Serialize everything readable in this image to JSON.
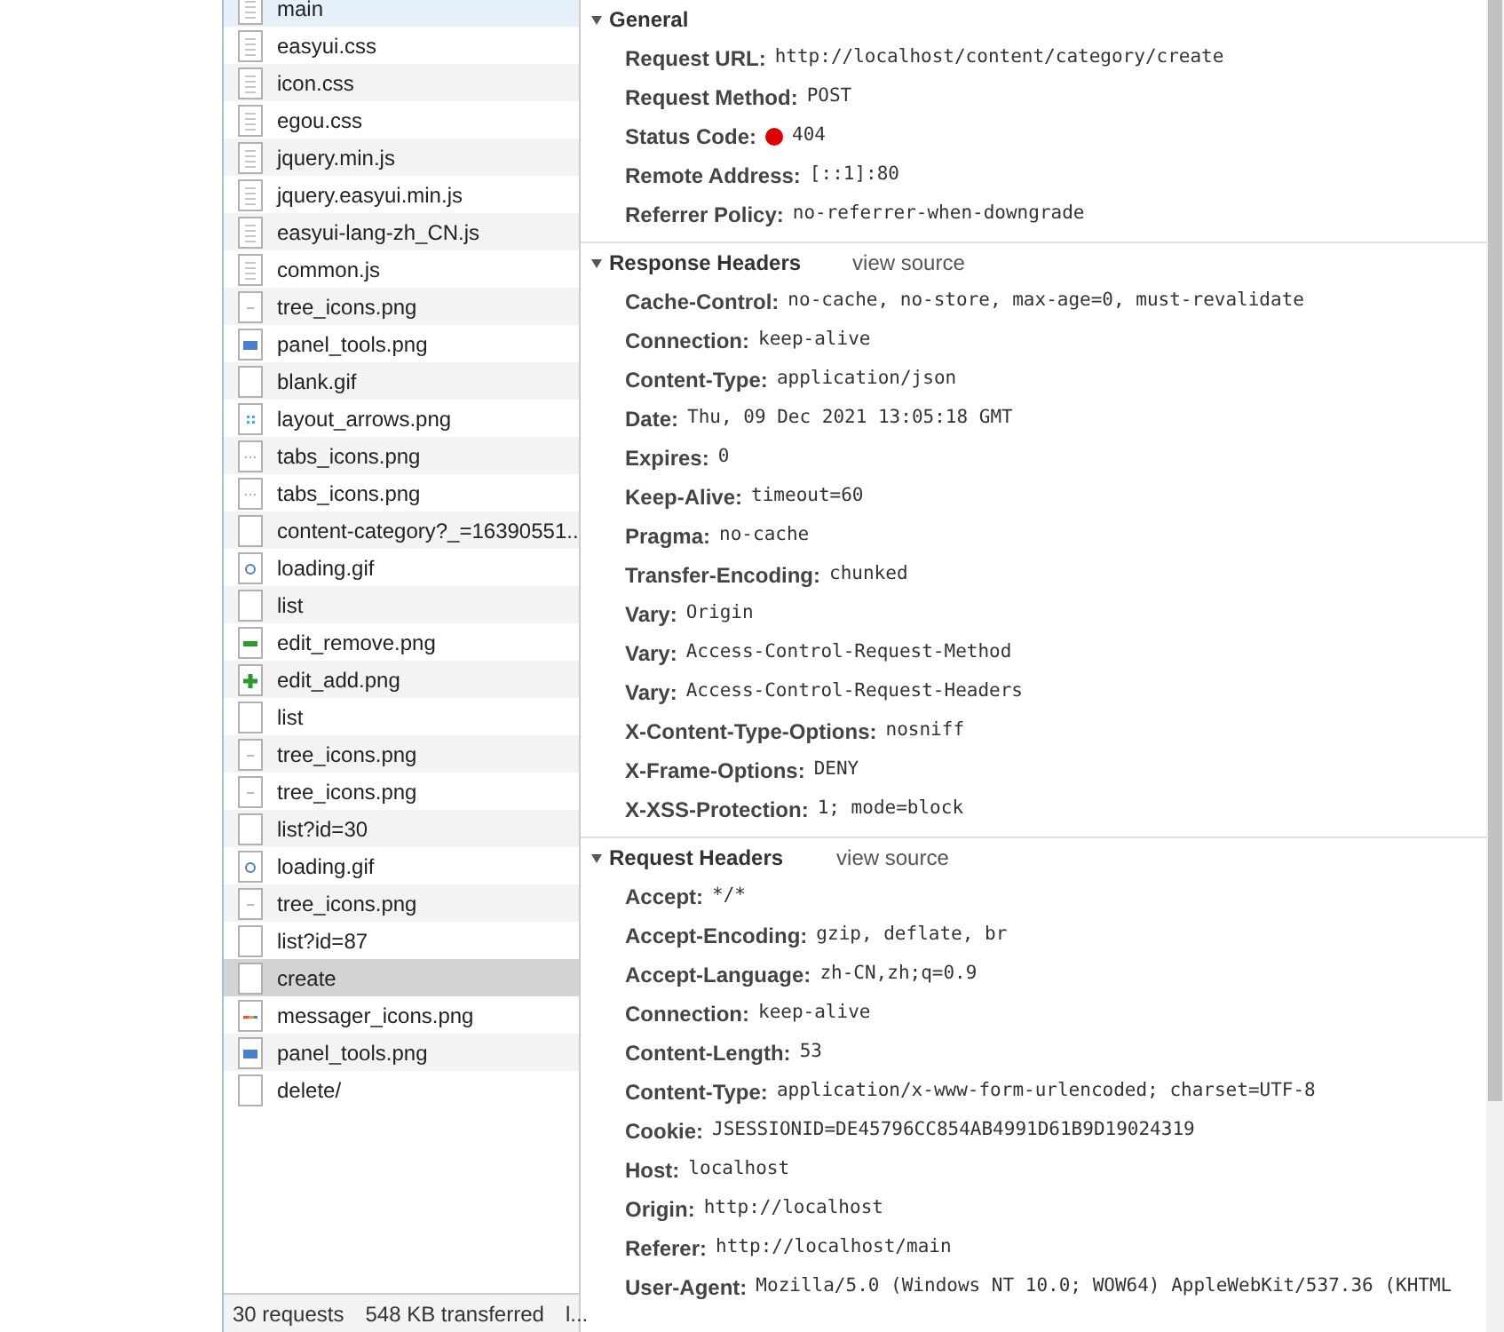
{
  "requests": [
    {
      "name": "main",
      "kind": "document",
      "highlighted": true,
      "selected": false
    },
    {
      "name": "easyui.css",
      "kind": "document",
      "highlighted": false,
      "selected": false
    },
    {
      "name": "icon.css",
      "kind": "document",
      "highlighted": false,
      "selected": false
    },
    {
      "name": "egou.css",
      "kind": "document",
      "highlighted": false,
      "selected": false
    },
    {
      "name": "jquery.min.js",
      "kind": "document",
      "highlighted": false,
      "selected": false
    },
    {
      "name": "jquery.easyui.min.js",
      "kind": "document",
      "highlighted": false,
      "selected": false
    },
    {
      "name": "easyui-lang-zh_CN.js",
      "kind": "document",
      "highlighted": false,
      "selected": false
    },
    {
      "name": "common.js",
      "kind": "document",
      "highlighted": false,
      "selected": false
    },
    {
      "name": "tree_icons.png",
      "kind": "dash",
      "highlighted": false,
      "selected": false
    },
    {
      "name": "panel_tools.png",
      "kind": "panel",
      "highlighted": false,
      "selected": false
    },
    {
      "name": "blank.gif",
      "kind": "blank",
      "highlighted": false,
      "selected": false
    },
    {
      "name": "layout_arrows.png",
      "kind": "grid",
      "highlighted": false,
      "selected": false
    },
    {
      "name": "tabs_icons.png",
      "kind": "dots",
      "highlighted": false,
      "selected": false
    },
    {
      "name": "tabs_icons.png",
      "kind": "dots",
      "highlighted": false,
      "selected": false
    },
    {
      "name": "content-category?_=16390551...",
      "kind": "blank",
      "highlighted": false,
      "selected": false
    },
    {
      "name": "loading.gif",
      "kind": "spinner",
      "highlighted": false,
      "selected": false
    },
    {
      "name": "list",
      "kind": "blank",
      "highlighted": false,
      "selected": false
    },
    {
      "name": "edit_remove.png",
      "kind": "minus",
      "highlighted": false,
      "selected": false
    },
    {
      "name": "edit_add.png",
      "kind": "plus",
      "highlighted": false,
      "selected": false
    },
    {
      "name": "list",
      "kind": "blank",
      "highlighted": false,
      "selected": false
    },
    {
      "name": "tree_icons.png",
      "kind": "dash",
      "highlighted": false,
      "selected": false
    },
    {
      "name": "tree_icons.png",
      "kind": "dash",
      "highlighted": false,
      "selected": false
    },
    {
      "name": "list?id=30",
      "kind": "blank",
      "highlighted": false,
      "selected": false
    },
    {
      "name": "loading.gif",
      "kind": "spinner",
      "highlighted": false,
      "selected": false
    },
    {
      "name": "tree_icons.png",
      "kind": "dash",
      "highlighted": false,
      "selected": false
    },
    {
      "name": "list?id=87",
      "kind": "blank",
      "highlighted": false,
      "selected": false
    },
    {
      "name": "create",
      "kind": "blank",
      "highlighted": false,
      "selected": true
    },
    {
      "name": "messager_icons.png",
      "kind": "message",
      "highlighted": false,
      "selected": false
    },
    {
      "name": "panel_tools.png",
      "kind": "panel",
      "highlighted": false,
      "selected": false
    },
    {
      "name": "delete/",
      "kind": "blank",
      "highlighted": false,
      "selected": false
    }
  ],
  "status_bar": [
    "30 requests",
    "548 KB transferred",
    "l..."
  ],
  "sections": [
    {
      "title": "General",
      "expanded": true,
      "rows": [
        {
          "key": "Request URL:",
          "value": "http://localhost/content/category/create",
          "kind": "plain"
        },
        {
          "key": "Request Method:",
          "value": "POST",
          "kind": "plain"
        },
        {
          "key": "Status Code:",
          "value": "404",
          "kind": "status"
        },
        {
          "key": "Remote Address:",
          "value": "[::1]:80",
          "kind": "plain"
        },
        {
          "key": "Referrer Policy:",
          "value": "no-referrer-when-downgrade",
          "kind": "plain"
        }
      ]
    },
    {
      "title": "Response Headers",
      "link": "view source",
      "expanded": true,
      "rows": [
        {
          "key": "Cache-Control:",
          "value": "no-cache, no-store, max-age=0, must-revalidate",
          "kind": "plain"
        },
        {
          "key": "Connection:",
          "value": "keep-alive",
          "kind": "plain"
        },
        {
          "key": "Content-Type:",
          "value": "application/json",
          "kind": "plain"
        },
        {
          "key": "Date:",
          "value": "Thu, 09 Dec 2021 13:05:18 GMT",
          "kind": "plain"
        },
        {
          "key": "Expires:",
          "value": "0",
          "kind": "plain"
        },
        {
          "key": "Keep-Alive:",
          "value": "timeout=60",
          "kind": "plain"
        },
        {
          "key": "Pragma:",
          "value": "no-cache",
          "kind": "plain"
        },
        {
          "key": "Transfer-Encoding:",
          "value": "chunked",
          "kind": "plain"
        },
        {
          "key": "Vary:",
          "value": "Origin",
          "kind": "plain"
        },
        {
          "key": "Vary:",
          "value": "Access-Control-Request-Method",
          "kind": "plain"
        },
        {
          "key": "Vary:",
          "value": "Access-Control-Request-Headers",
          "kind": "plain"
        },
        {
          "key": "X-Content-Type-Options:",
          "value": "nosniff",
          "kind": "plain"
        },
        {
          "key": "X-Frame-Options:",
          "value": "DENY",
          "kind": "plain"
        },
        {
          "key": "X-XSS-Protection:",
          "value": "1; mode=block",
          "kind": "plain"
        }
      ]
    },
    {
      "title": "Request Headers",
      "link": "view source",
      "expanded": true,
      "rows": [
        {
          "key": "Accept:",
          "value": "*/*",
          "kind": "plain"
        },
        {
          "key": "Accept-Encoding:",
          "value": "gzip, deflate, br",
          "kind": "plain"
        },
        {
          "key": "Accept-Language:",
          "value": "zh-CN,zh;q=0.9",
          "kind": "plain"
        },
        {
          "key": "Connection:",
          "value": "keep-alive",
          "kind": "plain"
        },
        {
          "key": "Content-Length:",
          "value": "53",
          "kind": "plain"
        },
        {
          "key": "Content-Type:",
          "value": "application/x-www-form-urlencoded; charset=UTF-8",
          "kind": "plain"
        },
        {
          "key": "Cookie:",
          "value": "JSESSIONID=DE45796CC854AB4991D61B9D19024319",
          "kind": "plain"
        },
        {
          "key": "Host:",
          "value": "localhost",
          "kind": "plain"
        },
        {
          "key": "Origin:",
          "value": "http://localhost",
          "kind": "plain"
        },
        {
          "key": "Referer:",
          "value": "http://localhost/main",
          "kind": "plain"
        },
        {
          "key": "User-Agent:",
          "value": "Mozilla/5.0 (Windows NT 10.0; WOW64) AppleWebKit/537.36 (KHTML",
          "kind": "plain"
        }
      ]
    }
  ]
}
